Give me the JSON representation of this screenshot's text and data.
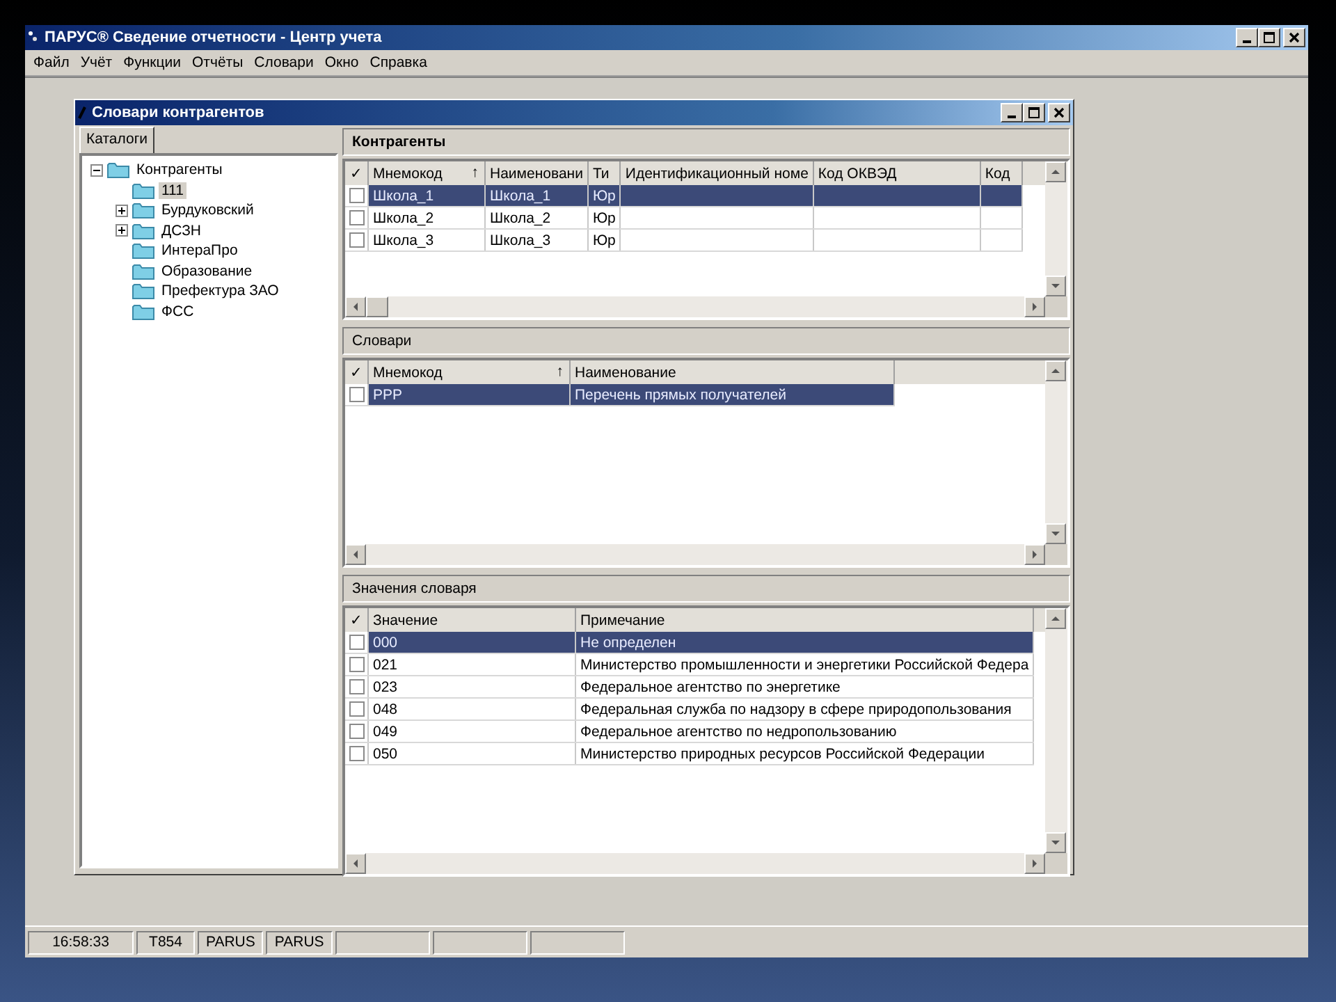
{
  "window": {
    "title": "ПАРУС® Сведение отчетности - Центр учета"
  },
  "menu": [
    "Файл",
    "Учёт",
    "Функции",
    "Отчёты",
    "Словари",
    "Окно",
    "Справка"
  ],
  "child_window": {
    "title": "Словари контрагентов"
  },
  "tabs": [
    {
      "label": "Каталоги",
      "selected": true
    }
  ],
  "tree": [
    {
      "label": "Контрагенты",
      "expanded": true,
      "selected": false,
      "children": [
        {
          "label": "111",
          "selected": true
        },
        {
          "label": "Бурдуковский",
          "expanded": false,
          "selected": false
        },
        {
          "label": "ДСЗН",
          "expanded": false,
          "selected": false
        },
        {
          "label": "ИнтераПро",
          "selected": false
        },
        {
          "label": "Образование",
          "selected": false
        },
        {
          "label": "Префектура ЗАО",
          "selected": false
        },
        {
          "label": "ФСС",
          "selected": false
        }
      ]
    }
  ],
  "sections": [
    {
      "title": "Контрагенты",
      "focused": true,
      "grid": {
        "check_header": "✓",
        "columns": [
          {
            "label": "Мнемокод",
            "sort_mark": "↑"
          },
          {
            "label": "Наименовани"
          },
          {
            "label": "Ти"
          },
          {
            "label": "Идентификационный номе"
          },
          {
            "label": "Код ОКВЭД"
          },
          {
            "label": "Код"
          }
        ],
        "rows": [
          {
            "checked": false,
            "selected": true,
            "cells": [
              "Школа_1",
              "Школа_1",
              "Юр"
            ]
          },
          {
            "checked": false,
            "selected": false,
            "cells": [
              "Школа_2",
              "Школа_2",
              "Юр"
            ]
          },
          {
            "checked": false,
            "selected": false,
            "cells": [
              "Школа_3",
              "Школа_3",
              "Юр"
            ]
          }
        ]
      }
    },
    {
      "title": "Словари",
      "focused": false,
      "grid": {
        "check_header": "✓",
        "columns": [
          {
            "label": "Мнемокод",
            "sort_mark": "↑"
          },
          {
            "label": "Наименование"
          }
        ],
        "rows": [
          {
            "checked": false,
            "selected": true,
            "cells": [
              "PPP",
              "Перечень прямых получателей"
            ]
          }
        ]
      }
    },
    {
      "title": "Значения словаря",
      "focused": false,
      "grid": {
        "check_header": "✓",
        "columns": [
          {
            "label": "Значение"
          },
          {
            "label": "Примечание"
          }
        ],
        "rows": [
          {
            "checked": false,
            "selected": true,
            "cells": [
              "000",
              "Не определен"
            ]
          },
          {
            "checked": false,
            "selected": false,
            "cells": [
              "021",
              "Министерство промышленности и энергетики Российской Федера"
            ]
          },
          {
            "checked": false,
            "selected": false,
            "cells": [
              "023",
              "Федеральное агентство по энергетике"
            ]
          },
          {
            "checked": false,
            "selected": false,
            "cells": [
              "048",
              "Федеральная служба по надзору в сфере природопользования"
            ]
          },
          {
            "checked": false,
            "selected": false,
            "cells": [
              "049",
              "Федеральное агентство по недропользованию"
            ]
          },
          {
            "checked": false,
            "selected": false,
            "cells": [
              "050",
              "Министерство природных ресурсов Российской Федерации"
            ]
          }
        ]
      }
    }
  ],
  "status_bar": [
    "16:58:33",
    "T854",
    "PARUS",
    "PARUS"
  ]
}
